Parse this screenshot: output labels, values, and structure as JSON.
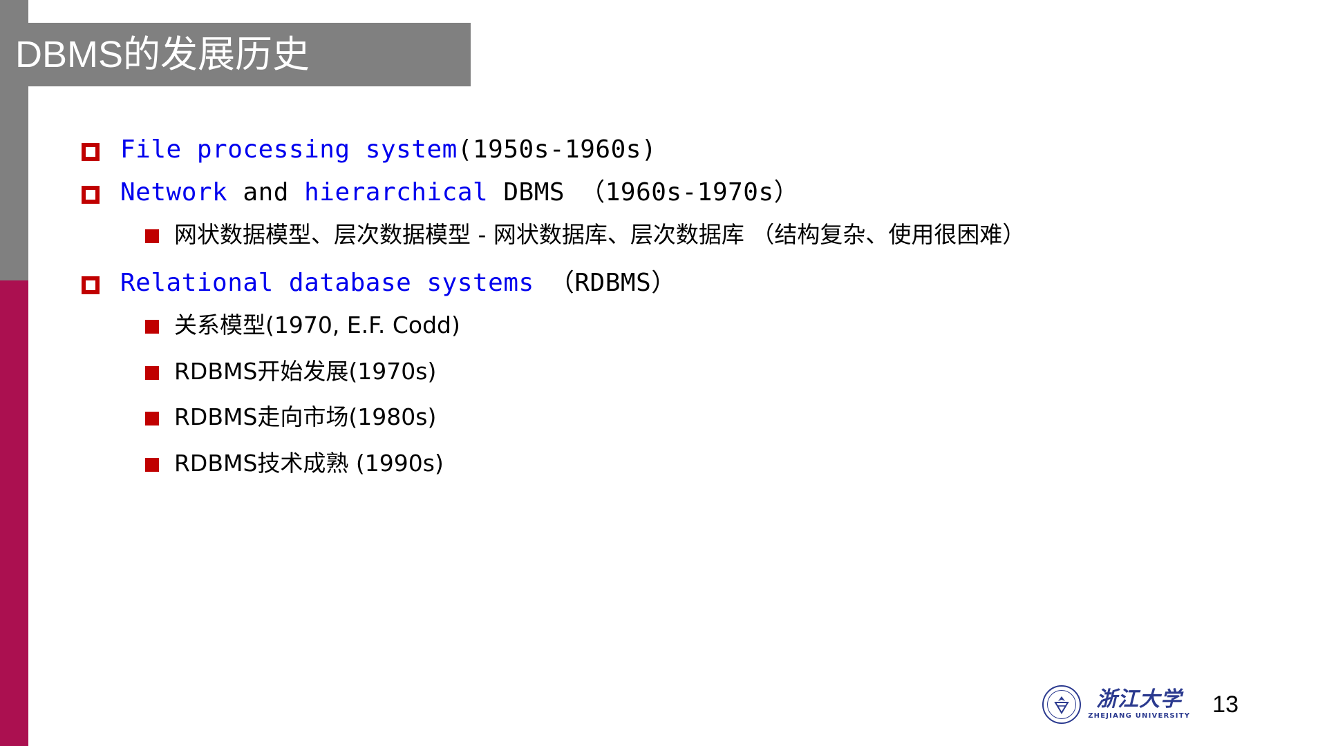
{
  "slide": {
    "title": "DBMS的发展历史",
    "page_number": "13",
    "colors": {
      "title_bar": "#808080",
      "stripe_gray": "#808080",
      "stripe_crimson": "#AB1050",
      "bullet_red": "#C00000",
      "accent_blue": "#0000EE",
      "logo_blue": "#2B3A8F"
    }
  },
  "bullets": [
    {
      "marker": "hollow-square",
      "segments": [
        {
          "text": "File processing system",
          "color": "blue"
        },
        {
          "text": "(1950s-1960s)",
          "color": "black"
        }
      ],
      "plain": "File processing system(1950s-1960s)",
      "sub": []
    },
    {
      "marker": "hollow-square",
      "segments": [
        {
          "text": "Network",
          "color": "blue"
        },
        {
          "text": " and ",
          "color": "black"
        },
        {
          "text": "hierarchical",
          "color": "blue"
        },
        {
          "text": " DBMS （1960s-1970s）",
          "color": "black"
        }
      ],
      "plain": "Network and hierarchical DBMS （1960s-1970s）",
      "sub": [
        {
          "text": "网状数据模型、层次数据模型 - 网状数据库、层次数据库 （结构复杂、使用很困难）"
        }
      ]
    },
    {
      "marker": "hollow-square",
      "segments": [
        {
          "text": "Relational database systems",
          "color": "blue"
        },
        {
          "text": " （RDBMS）",
          "color": "black"
        }
      ],
      "plain": "Relational database systems （RDBMS）",
      "sub": [
        {
          "text": "关系模型(1970, E.F. Codd)"
        },
        {
          "text": "RDBMS开始发展(1970s)"
        },
        {
          "text": "RDBMS走向市场(1980s)"
        },
        {
          "text": "RDBMS技术成熟 (1990s)"
        }
      ]
    }
  ],
  "footer": {
    "logo_cn": "浙江大学",
    "logo_en": "ZHEJIANG UNIVERSITY",
    "page_number": "13"
  }
}
